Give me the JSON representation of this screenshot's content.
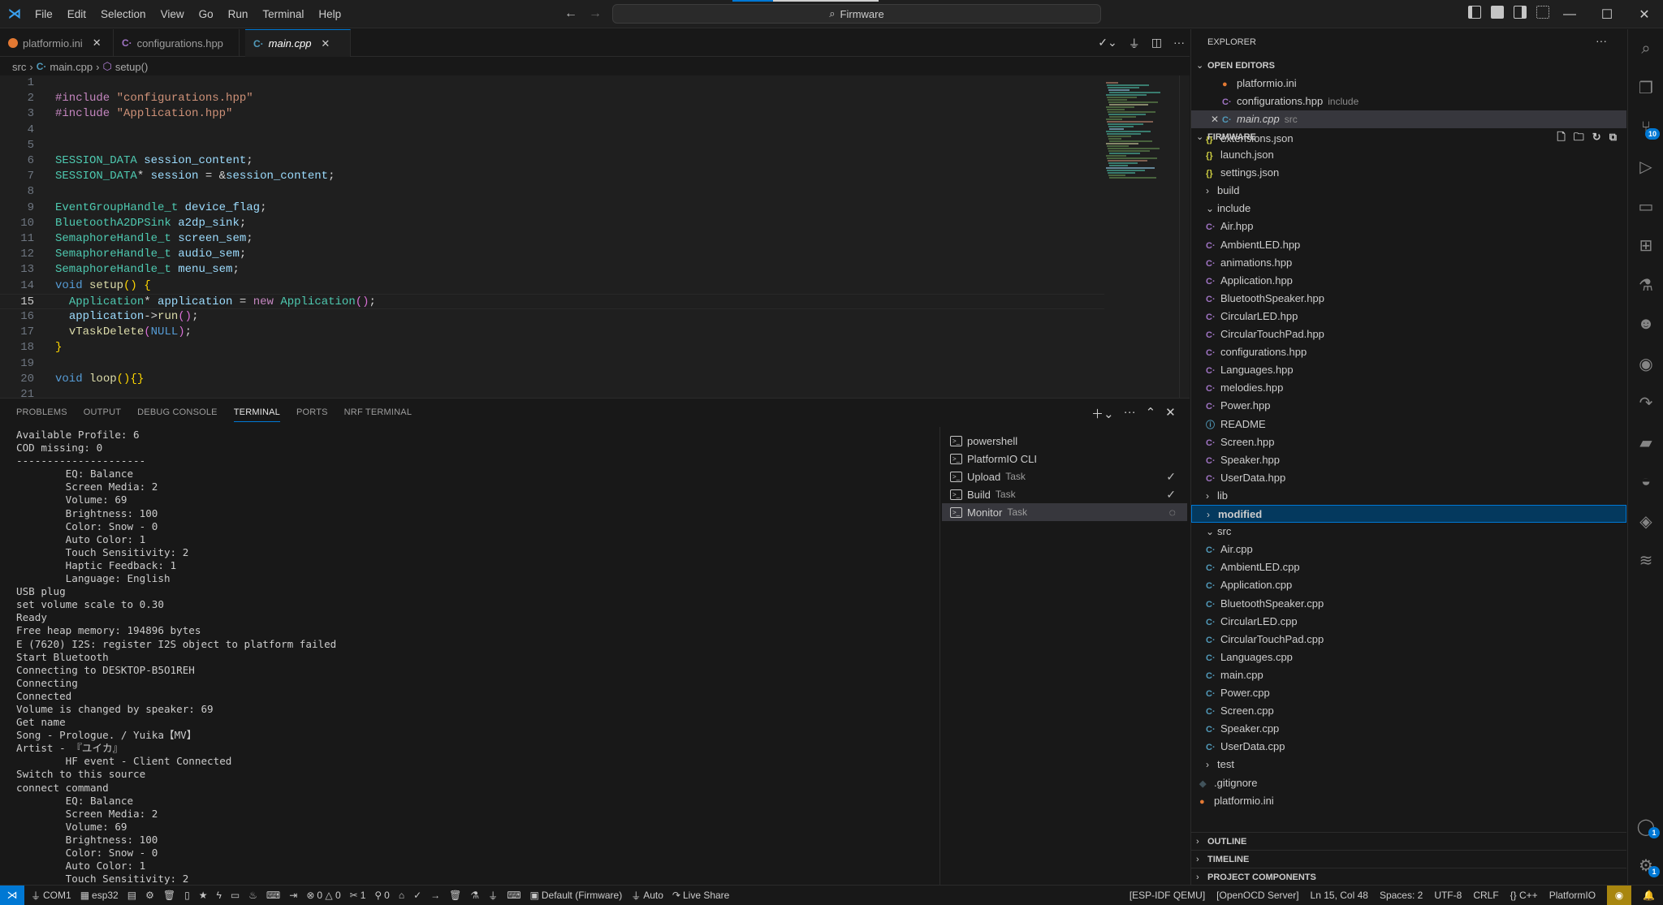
{
  "titlebar": {
    "menu": [
      "File",
      "Edit",
      "Selection",
      "View",
      "Go",
      "Run",
      "Terminal",
      "Help"
    ],
    "search_text": "Firmware",
    "icons": {
      "logo": "vscode-logo-icon",
      "back": "arrow-left-icon",
      "forward": "arrow-right-icon",
      "search": "search-icon"
    }
  },
  "tabs": [
    {
      "label": "platformio.ini",
      "icon": "platformio-icon",
      "active": false,
      "closable": true
    },
    {
      "label": "configurations.hpp",
      "icon": "cpp-header-icon",
      "active": false,
      "closable": false
    },
    {
      "label": "main.cpp",
      "icon": "cpp-icon",
      "active": true,
      "closable": true
    }
  ],
  "breadcrumb": [
    "src",
    "main.cpp",
    "setup()"
  ],
  "editor": {
    "current_line": 15,
    "lines": [
      {
        "n": "1",
        "tokens": []
      },
      {
        "n": "2",
        "tokens": [
          [
            "pre",
            "#include "
          ],
          [
            "str",
            "\"configurations.hpp\""
          ]
        ]
      },
      {
        "n": "3",
        "tokens": [
          [
            "pre",
            "#include "
          ],
          [
            "str",
            "\"Application.hpp\""
          ]
        ]
      },
      {
        "n": "4",
        "tokens": []
      },
      {
        "n": "5",
        "tokens": []
      },
      {
        "n": "6",
        "tokens": [
          [
            "type",
            "SESSION_DATA"
          ],
          [
            "p",
            " "
          ],
          [
            "var",
            "session_content"
          ],
          [
            "p",
            ";"
          ]
        ]
      },
      {
        "n": "7",
        "tokens": [
          [
            "type",
            "SESSION_DATA"
          ],
          [
            "p",
            "* "
          ],
          [
            "var",
            "session"
          ],
          [
            "p",
            " = &"
          ],
          [
            "var",
            "session_content"
          ],
          [
            "p",
            ";"
          ]
        ]
      },
      {
        "n": "8",
        "tokens": []
      },
      {
        "n": "9",
        "tokens": [
          [
            "type",
            "EventGroupHandle_t"
          ],
          [
            "p",
            " "
          ],
          [
            "var",
            "device_flag"
          ],
          [
            "p",
            ";"
          ]
        ]
      },
      {
        "n": "10",
        "tokens": [
          [
            "type",
            "BluetoothA2DPSink"
          ],
          [
            "p",
            " "
          ],
          [
            "var",
            "a2dp_sink"
          ],
          [
            "p",
            ";"
          ]
        ]
      },
      {
        "n": "11",
        "tokens": [
          [
            "type",
            "SemaphoreHandle_t"
          ],
          [
            "p",
            " "
          ],
          [
            "var",
            "screen_sem"
          ],
          [
            "p",
            ";"
          ]
        ]
      },
      {
        "n": "12",
        "tokens": [
          [
            "type",
            "SemaphoreHandle_t"
          ],
          [
            "p",
            " "
          ],
          [
            "var",
            "audio_sem"
          ],
          [
            "p",
            ";"
          ]
        ]
      },
      {
        "n": "13",
        "tokens": [
          [
            "type",
            "SemaphoreHandle_t"
          ],
          [
            "p",
            " "
          ],
          [
            "var",
            "menu_sem"
          ],
          [
            "p",
            ";"
          ]
        ]
      },
      {
        "n": "14",
        "tokens": [
          [
            "kw",
            "void"
          ],
          [
            "p",
            " "
          ],
          [
            "fn",
            "setup"
          ],
          [
            "br",
            "()"
          ],
          [
            "p",
            " "
          ],
          [
            "br",
            "{"
          ]
        ]
      },
      {
        "n": "15",
        "tokens": [
          [
            "p",
            "  "
          ],
          [
            "type",
            "Application"
          ],
          [
            "p",
            "* "
          ],
          [
            "var",
            "application"
          ],
          [
            "p",
            " = "
          ],
          [
            "pre",
            "new"
          ],
          [
            "p",
            " "
          ],
          [
            "type",
            "Application"
          ],
          [
            "br2",
            "()"
          ],
          [
            "p",
            ";"
          ]
        ]
      },
      {
        "n": "16",
        "tokens": [
          [
            "p",
            "  "
          ],
          [
            "var",
            "application"
          ],
          [
            "p",
            "->"
          ],
          [
            "fn",
            "run"
          ],
          [
            "br2",
            "()"
          ],
          [
            "p",
            ";"
          ]
        ]
      },
      {
        "n": "17",
        "tokens": [
          [
            "p",
            "  "
          ],
          [
            "fn",
            "vTaskDelete"
          ],
          [
            "br2",
            "("
          ],
          [
            "null",
            "NULL"
          ],
          [
            "br2",
            ")"
          ],
          [
            "p",
            ";"
          ]
        ]
      },
      {
        "n": "18",
        "tokens": [
          [
            "br",
            "}"
          ]
        ]
      },
      {
        "n": "19",
        "tokens": []
      },
      {
        "n": "20",
        "tokens": [
          [
            "kw",
            "void"
          ],
          [
            "p",
            " "
          ],
          [
            "fn",
            "loop"
          ],
          [
            "br",
            "(){}"
          ]
        ]
      },
      {
        "n": "21",
        "tokens": []
      }
    ]
  },
  "panel": {
    "tabs": [
      "PROBLEMS",
      "OUTPUT",
      "DEBUG CONSOLE",
      "TERMINAL",
      "PORTS",
      "NRF TERMINAL"
    ],
    "active_tab": "TERMINAL",
    "terminal_lines": [
      "Available Profile: 6",
      "COD missing: 0",
      "---------------------",
      "        EQ: Balance",
      "        Screen Media: 2",
      "        Volume: 69",
      "        Brightness: 100",
      "        Color: Snow - 0",
      "        Auto Color: 1",
      "        Touch Sensitivity: 2",
      "        Haptic Feedback: 1",
      "        Language: English",
      "USB plug",
      "set volume scale to 0.30",
      "Ready",
      "Free heap memory: 194896 bytes",
      "E (7620) I2S: register I2S object to platform failed",
      "Start Bluetooth",
      "Connecting to DESKTOP-B5O1REH",
      "Connecting",
      "Connected",
      "Volume is changed by speaker: 69",
      "Get name",
      "Song - Prologue. / Yuika【MV】",
      "Artist - 『ユイカ』",
      "        HF event - Client Connected",
      "Switch to this source",
      "connect command",
      "        EQ: Balance",
      "        Screen Media: 2",
      "        Volume: 69",
      "        Brightness: 100",
      "        Color: Snow - 0",
      "        Auto Color: 1",
      "        Touch Sensitivity: 2"
    ],
    "terminals": [
      {
        "name": "powershell",
        "sub": "",
        "status": ""
      },
      {
        "name": "PlatformIO CLI",
        "sub": "",
        "status": ""
      },
      {
        "name": "Upload",
        "sub": "Task",
        "status": "✓"
      },
      {
        "name": "Build",
        "sub": "Task",
        "status": "✓"
      },
      {
        "name": "Monitor",
        "sub": "Task",
        "status": "◌",
        "active": true
      }
    ]
  },
  "explorer": {
    "title": "EXPLORER",
    "open_editors_label": "OPEN EDITORS",
    "open_editors": [
      {
        "name": "platformio.ini",
        "desc": "",
        "icon": "pio"
      },
      {
        "name": "configurations.hpp",
        "desc": "include",
        "icon": "h"
      },
      {
        "name": "main.cpp",
        "desc": "src",
        "icon": "c",
        "active": true
      }
    ],
    "workspace_label": "FIRMWARE",
    "tree": [
      {
        "name": "extensions.json",
        "icon": "json",
        "depth": 1,
        "partial": true
      },
      {
        "name": "launch.json",
        "icon": "json",
        "depth": 1
      },
      {
        "name": "settings.json",
        "icon": "json",
        "depth": 1
      },
      {
        "name": "build",
        "type": "folder",
        "open": false,
        "depth": 0
      },
      {
        "name": "include",
        "type": "folder",
        "open": true,
        "depth": 0
      },
      {
        "name": "Air.hpp",
        "icon": "h",
        "depth": 1
      },
      {
        "name": "AmbientLED.hpp",
        "icon": "h",
        "depth": 1
      },
      {
        "name": "animations.hpp",
        "icon": "h",
        "depth": 1
      },
      {
        "name": "Application.hpp",
        "icon": "h",
        "depth": 1
      },
      {
        "name": "BluetoothSpeaker.hpp",
        "icon": "h",
        "depth": 1
      },
      {
        "name": "CircularLED.hpp",
        "icon": "h",
        "depth": 1
      },
      {
        "name": "CircularTouchPad.hpp",
        "icon": "h",
        "depth": 1
      },
      {
        "name": "configurations.hpp",
        "icon": "h",
        "depth": 1
      },
      {
        "name": "Languages.hpp",
        "icon": "h",
        "depth": 1
      },
      {
        "name": "melodies.hpp",
        "icon": "h",
        "depth": 1
      },
      {
        "name": "Power.hpp",
        "icon": "h",
        "depth": 1
      },
      {
        "name": "README",
        "icon": "info",
        "depth": 1
      },
      {
        "name": "Screen.hpp",
        "icon": "h",
        "depth": 1
      },
      {
        "name": "Speaker.hpp",
        "icon": "h",
        "depth": 1
      },
      {
        "name": "UserData.hpp",
        "icon": "h",
        "depth": 1
      },
      {
        "name": "lib",
        "type": "folder",
        "open": false,
        "depth": 0
      },
      {
        "name": "modified",
        "type": "folder",
        "open": false,
        "depth": 0,
        "selected": true
      },
      {
        "name": "src",
        "type": "folder",
        "open": true,
        "depth": 0
      },
      {
        "name": "Air.cpp",
        "icon": "c",
        "depth": 1
      },
      {
        "name": "AmbientLED.cpp",
        "icon": "c",
        "depth": 1
      },
      {
        "name": "Application.cpp",
        "icon": "c",
        "depth": 1
      },
      {
        "name": "BluetoothSpeaker.cpp",
        "icon": "c",
        "depth": 1
      },
      {
        "name": "CircularLED.cpp",
        "icon": "c",
        "depth": 1
      },
      {
        "name": "CircularTouchPad.cpp",
        "icon": "c",
        "depth": 1
      },
      {
        "name": "Languages.cpp",
        "icon": "c",
        "depth": 1
      },
      {
        "name": "main.cpp",
        "icon": "c",
        "depth": 1
      },
      {
        "name": "Power.cpp",
        "icon": "c",
        "depth": 1
      },
      {
        "name": "Screen.cpp",
        "icon": "c",
        "depth": 1
      },
      {
        "name": "Speaker.cpp",
        "icon": "c",
        "depth": 1
      },
      {
        "name": "UserData.cpp",
        "icon": "c",
        "depth": 1
      },
      {
        "name": "test",
        "type": "folder",
        "open": false,
        "depth": 0
      },
      {
        "name": ".gitignore",
        "icon": "git",
        "depth": -1
      },
      {
        "name": "platformio.ini",
        "icon": "pio",
        "depth": -1
      }
    ],
    "bottom_sections": [
      "OUTLINE",
      "TIMELINE",
      "PROJECT COMPONENTS"
    ]
  },
  "activity_bar": {
    "items": [
      {
        "name": "search",
        "glyph": "⌕"
      },
      {
        "name": "explorer",
        "glyph": "❐"
      },
      {
        "name": "source-control",
        "glyph": "⑂",
        "badge": "10"
      },
      {
        "name": "run-debug",
        "glyph": "▷"
      },
      {
        "name": "remote-explorer",
        "glyph": "▭"
      },
      {
        "name": "extensions",
        "glyph": "⊞"
      },
      {
        "name": "testing",
        "glyph": "⚗"
      },
      {
        "name": "platformio",
        "glyph": "☻"
      },
      {
        "name": "github",
        "glyph": "◉"
      },
      {
        "name": "live-share",
        "glyph": "↷"
      },
      {
        "name": "docker",
        "glyph": "▰"
      },
      {
        "name": "serial-monitor",
        "glyph": "◒"
      },
      {
        "name": "esp-idf",
        "glyph": "◈"
      },
      {
        "name": "espressif",
        "glyph": "≋"
      }
    ],
    "bottom": [
      {
        "name": "accounts",
        "glyph": "◯",
        "badge": "1"
      },
      {
        "name": "manage",
        "glyph": "⚙",
        "badge": "1"
      }
    ]
  },
  "statusbar": {
    "left": [
      {
        "name": "port",
        "glyph": "⏚",
        "text": "COM1"
      },
      {
        "name": "board",
        "glyph": "▦",
        "text": "esp32"
      },
      {
        "name": "folder",
        "glyph": "▤",
        "text": ""
      },
      {
        "name": "settings",
        "glyph": "⚙",
        "text": ""
      },
      {
        "name": "delete",
        "glyph": "🗑",
        "text": ""
      },
      {
        "name": "flash",
        "glyph": "▯",
        "text": ""
      },
      {
        "name": "star",
        "glyph": "★",
        "text": ""
      },
      {
        "name": "bolt",
        "glyph": "ϟ",
        "text": ""
      },
      {
        "name": "monitor",
        "glyph": "▭",
        "text": ""
      },
      {
        "name": "fire",
        "glyph": "♨",
        "text": ""
      },
      {
        "name": "terminal",
        "glyph": "⌨",
        "text": ""
      },
      {
        "name": "import",
        "glyph": "⇥",
        "text": ""
      },
      {
        "name": "problems",
        "glyph": "⊗",
        "text": "0 △ 0"
      },
      {
        "name": "tools",
        "glyph": "✂",
        "text": "1"
      },
      {
        "name": "ports",
        "glyph": "⚲",
        "text": "0"
      },
      {
        "name": "home",
        "glyph": "⌂",
        "text": ""
      },
      {
        "name": "build",
        "glyph": "✓",
        "text": ""
      },
      {
        "name": "upload",
        "glyph": "→",
        "text": ""
      },
      {
        "name": "clean",
        "glyph": "🗑",
        "text": ""
      },
      {
        "name": "test",
        "glyph": "⚗",
        "text": ""
      },
      {
        "name": "plug",
        "glyph": "⏚",
        "text": ""
      },
      {
        "name": "pio-terminal",
        "glyph": "⌨",
        "text": ""
      },
      {
        "name": "env",
        "glyph": "▣",
        "text": "Default (Firmware)"
      },
      {
        "name": "auto",
        "glyph": "⏚",
        "text": "Auto"
      },
      {
        "name": "live-share",
        "glyph": "↷",
        "text": "Live Share"
      }
    ],
    "right": [
      "[ESP-IDF QEMU]",
      "[OpenOCD Server]",
      "Ln 15, Col 48",
      "Spaces: 2",
      "UTF-8",
      "CRLF",
      "{} C++",
      "PlatformIO"
    ]
  }
}
